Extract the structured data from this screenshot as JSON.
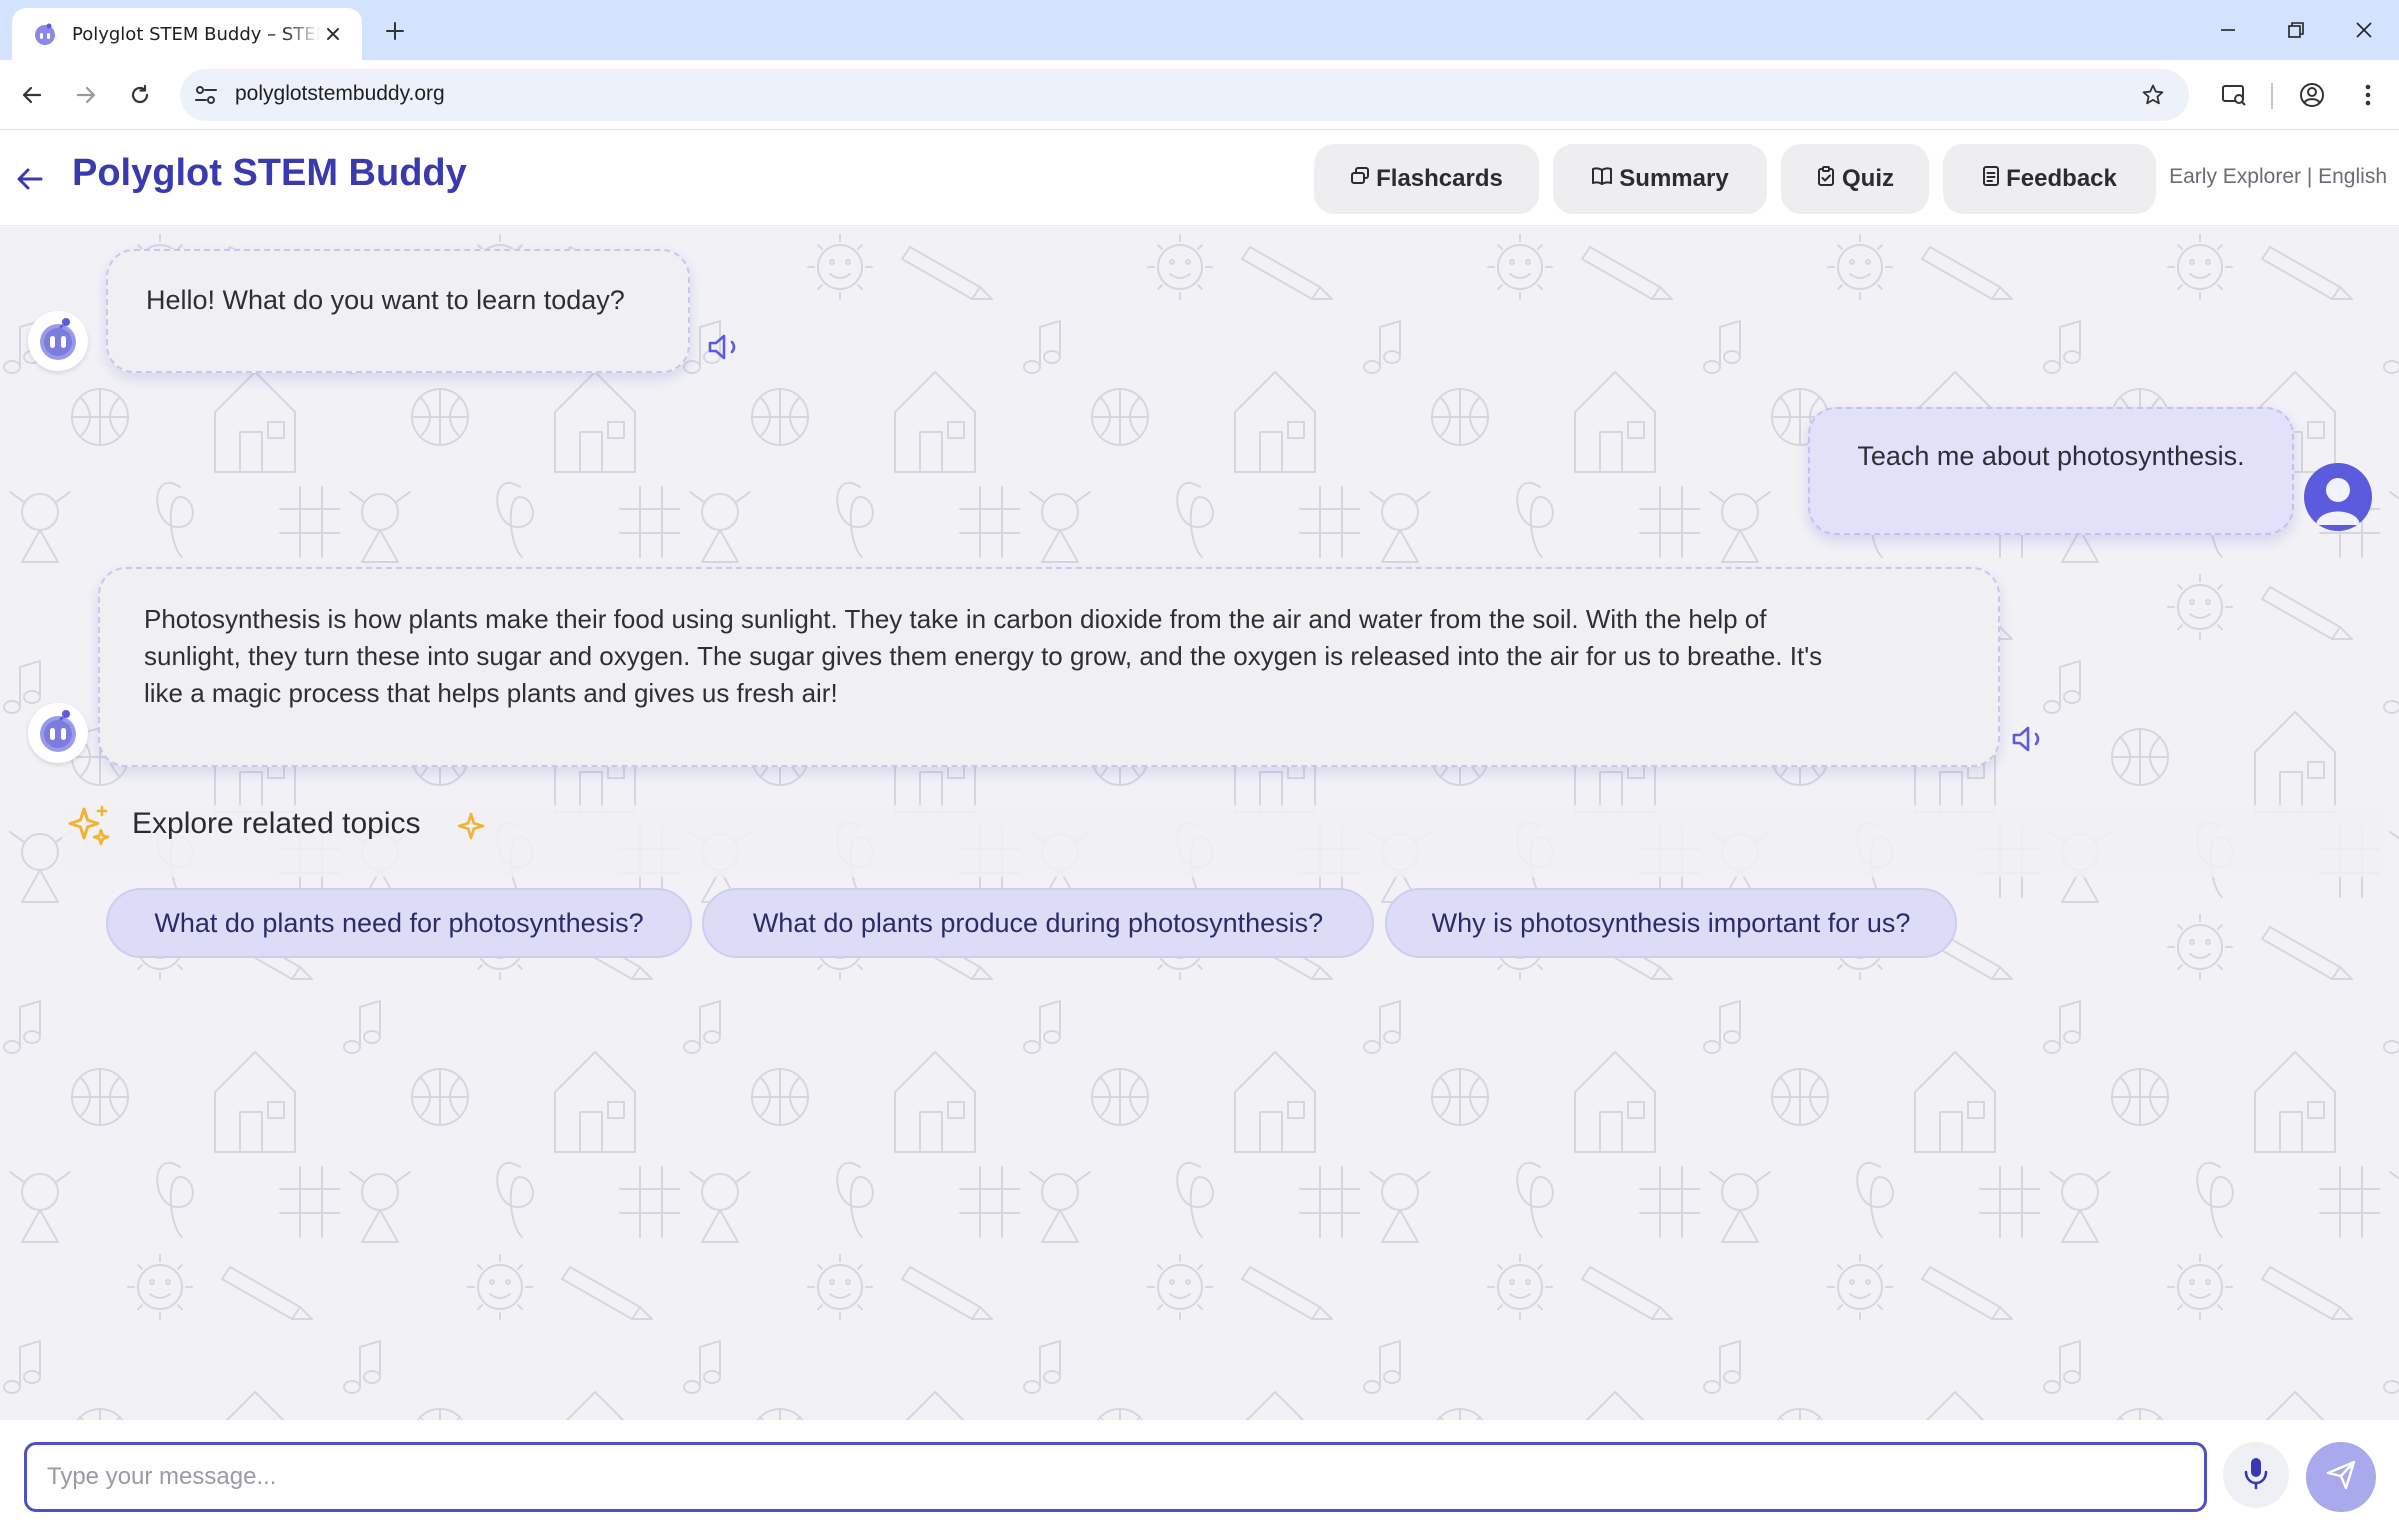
{
  "browser": {
    "tab_title": "Polyglot STEM Buddy – STEM learning",
    "url": "polyglotstembuddy.org"
  },
  "header": {
    "title": "Polyglot STEM Buddy",
    "buttons": {
      "flashcards": "Flashcards",
      "summary": "Summary",
      "quiz": "Quiz",
      "feedback": "Feedback"
    },
    "level_info": "Early Explorer | English"
  },
  "messages": [
    {
      "role": "bot",
      "text": "Hello! What do you want to learn today?"
    },
    {
      "role": "user",
      "text": "Teach me about photosynthesis."
    },
    {
      "role": "bot",
      "lines": [
        "Photosynthesis is how plants make their food using sunlight. They take in carbon dioxide from the air and water from the soil. With the help of",
        "sunlight, they turn these into sugar and oxygen. The sugar gives them energy to grow, and the oxygen is released into the air for us to breathe. It's",
        "like a magic process that helps plants and gives us fresh air!"
      ]
    }
  ],
  "explore": {
    "title": "Explore related topics",
    "topics": [
      "What do plants need for photosynthesis?",
      "What do plants produce during photosynthesis?",
      "Why is photosynthesis important for us?"
    ]
  },
  "composer": {
    "placeholder": "Type your message..."
  },
  "colors": {
    "brand": "#3a3ab0",
    "accent": "#5b5bde",
    "send_button": "#a9a9ee",
    "sparkle": "#f2b233"
  },
  "icons": {
    "tab_favicon": "robot-icon",
    "back": "arrow-left-icon",
    "flashcards": "cards-icon",
    "summary": "book-icon",
    "quiz": "clipboard-check-icon",
    "feedback": "form-icon",
    "speaker": "speaker-icon",
    "sparkle": "sparkle-icon",
    "mic": "microphone-icon",
    "send": "send-icon"
  }
}
